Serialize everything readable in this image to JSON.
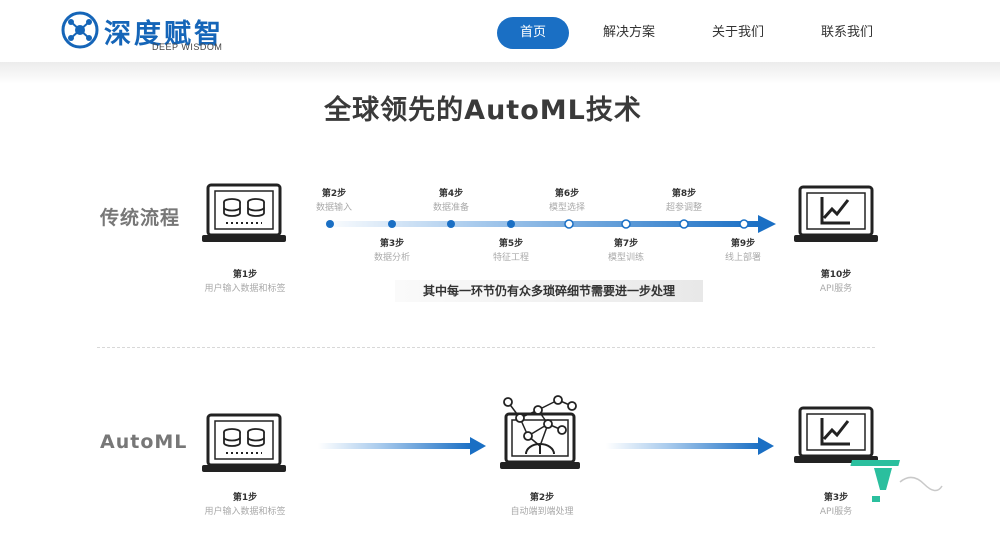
{
  "header": {
    "logo_text": "深度赋智",
    "logo_sub": "DEEP WISDOM",
    "nav": [
      {
        "label": "首页",
        "active": true
      },
      {
        "label": "解决方案",
        "active": false
      },
      {
        "label": "关于我们",
        "active": false
      },
      {
        "label": "联系我们",
        "active": false
      }
    ]
  },
  "main": {
    "title": "全球领先的AutoML技术",
    "traditional": {
      "label": "传统流程",
      "start": {
        "step": "第1步",
        "desc": "用户输入数据和标签"
      },
      "top_steps": [
        {
          "step": "第2步",
          "desc": "数据输入"
        },
        {
          "step": "第4步",
          "desc": "数据准备"
        },
        {
          "step": "第6步",
          "desc": "模型选择"
        },
        {
          "step": "第8步",
          "desc": "超参调整"
        }
      ],
      "bottom_steps": [
        {
          "step": "第3步",
          "desc": "数据分析"
        },
        {
          "step": "第5步",
          "desc": "特征工程"
        },
        {
          "step": "第7步",
          "desc": "模型训练"
        },
        {
          "step": "第9步",
          "desc": "线上部署"
        }
      ],
      "end": {
        "step": "第10步",
        "desc": "API服务"
      },
      "note": "其中每一环节仍有众多琐碎细节需要进一步处理"
    },
    "automl": {
      "label": "AutoML",
      "steps": [
        {
          "step": "第1步",
          "desc": "用户输入数据和标签"
        },
        {
          "step": "第2步",
          "desc": "自动端到端处理"
        },
        {
          "step": "第3步",
          "desc": "API服务"
        }
      ]
    }
  },
  "colors": {
    "brand": "#1565b8",
    "nav_active": "#1a6fc4",
    "arrow": "#1a6fc4",
    "watermark": "#2bbf9e"
  },
  "icons": {
    "logo": "brain-network-icon",
    "data_laptop": "laptop-database-icon",
    "api_laptop": "laptop-chart-icon",
    "automl_laptop": "laptop-network-icon"
  }
}
